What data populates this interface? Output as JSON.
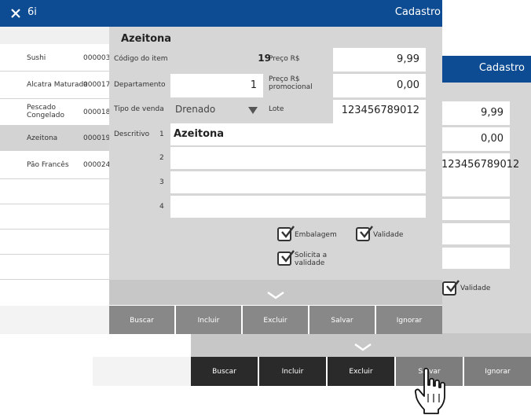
{
  "back": {
    "title": "Cadastro",
    "preco": "9,99",
    "preco_promo": "0,00",
    "lote": "123456789012",
    "check_label": "Validade",
    "buttons": [
      "Buscar",
      "Incluir",
      "Excluir",
      "Salvar",
      "Ignorar"
    ]
  },
  "front": {
    "header_title": "6i",
    "header_right": "Cadastro",
    "item_name": "Azeitona",
    "list": [
      {
        "name": "Sushi",
        "code": "000003"
      },
      {
        "name": "Alcatra Maturada",
        "code": "000017"
      },
      {
        "name": "Pescado Congelado",
        "code": "000018"
      },
      {
        "name": "Azeitona",
        "code": "000019"
      },
      {
        "name": "Pão Francês",
        "code": "000024"
      }
    ],
    "labels": {
      "codigo": "Código do item",
      "departamento": "Departamento",
      "tipo_venda": "Tipo de venda",
      "descritivo": "Descritivo",
      "preco": "Preço R$",
      "preco_promo": "Preço R$ promocional",
      "lote": "Lote"
    },
    "values": {
      "codigo": "19",
      "departamento": "1",
      "tipo_venda": "Drenado",
      "preco": "9,99",
      "preco_promo": "0,00",
      "lote": "123456789012",
      "desc1": "Azeitona"
    },
    "desc_line_numbers": [
      "1",
      "2",
      "3",
      "4"
    ],
    "checks": {
      "embalagem": "Embalagem",
      "validade": "Validade",
      "solicita": "Solicita a validade"
    },
    "buttons": [
      "Buscar",
      "Incluir",
      "Excluir",
      "Salvar",
      "Ignorar"
    ]
  },
  "icons": [
    "close-icon",
    "chevron-down-icon",
    "dropdown-arrow-icon",
    "checkmark-icon",
    "hand-pointer-icon"
  ]
}
